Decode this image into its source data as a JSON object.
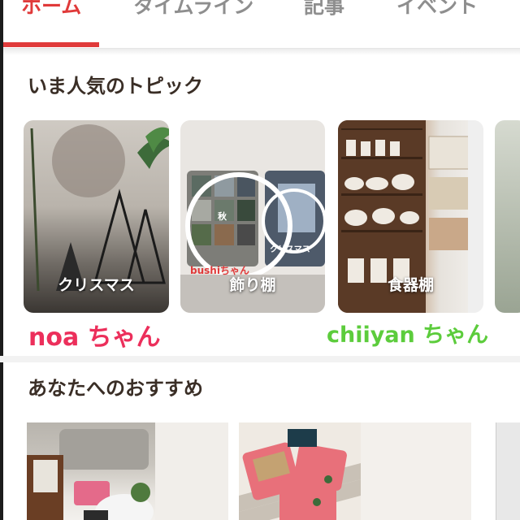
{
  "tabs": [
    {
      "label": "ホーム",
      "active": true
    },
    {
      "label": "タイムライン",
      "active": false
    },
    {
      "label": "記事",
      "active": false
    },
    {
      "label": "イベント",
      "active": false
    }
  ],
  "popular": {
    "title": "いま人気のトピック",
    "cards": [
      {
        "label": "クリスマス"
      },
      {
        "label": "飾り棚",
        "inner_labels": [
          "秋",
          "クリスマス",
          "bushiちゃん"
        ]
      },
      {
        "label": "食器棚"
      }
    ]
  },
  "annotations": {
    "left_name": "noa ちゃん",
    "right_name": "chiiyan ちゃん"
  },
  "recommend": {
    "title": "あなたへのおすすめ"
  },
  "colors": {
    "accent": "#e03a3a",
    "annotation_pink": "#ec2f5b",
    "annotation_green": "#5ccc3c",
    "title_brown": "#3a2e26"
  }
}
